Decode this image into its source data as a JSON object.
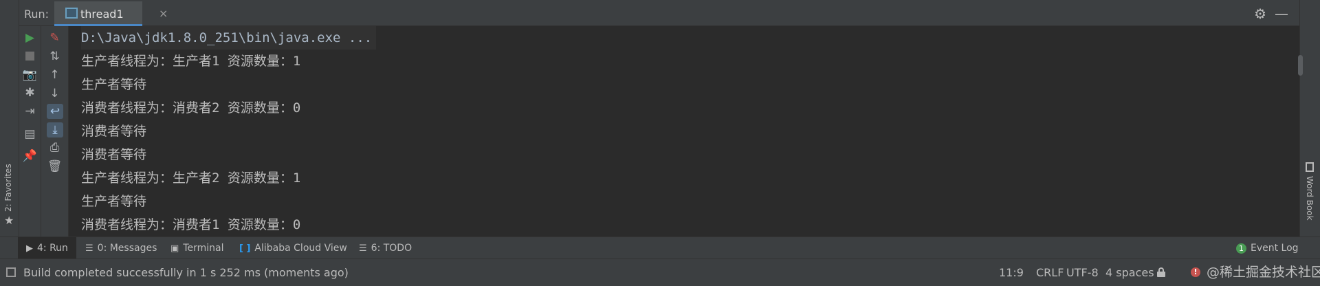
{
  "run_header": {
    "run_label": "Run:",
    "tab_label": "thread1",
    "tab_close": "×",
    "settings_icon": "⚙",
    "minimize_icon": "—"
  },
  "left_strip": {
    "favorites_label": "2: Favorites",
    "star_icon": "★"
  },
  "right_strip": {
    "wordbook_label": "Word Book"
  },
  "toolbar_1": [
    {
      "name": "rerun-icon",
      "glyph": "▶",
      "state": "active"
    },
    {
      "name": "stop-icon",
      "glyph": "■",
      "state": "disabled"
    },
    {
      "name": "camera-icon",
      "glyph": "📷",
      "state": "normal"
    },
    {
      "name": "debug-icon",
      "glyph": "✱",
      "state": "normal"
    },
    {
      "name": "exit-icon",
      "glyph": "⇥",
      "state": "normal"
    },
    {
      "name": "layout-icon",
      "glyph": "▤",
      "state": "normal"
    },
    {
      "name": "pin-icon",
      "glyph": "📌",
      "state": "normal"
    }
  ],
  "toolbar_2": [
    {
      "name": "clear-icon",
      "glyph": "✎",
      "state": "red"
    },
    {
      "name": "sort-icon",
      "glyph": "⇅",
      "state": "normal"
    },
    {
      "name": "up-arrow-icon",
      "glyph": "↑",
      "state": "normal"
    },
    {
      "name": "down-arrow-icon",
      "glyph": "↓",
      "state": "normal"
    },
    {
      "name": "soft-wrap-icon",
      "glyph": "↩",
      "state": "selected"
    },
    {
      "name": "scroll-to-end-icon",
      "glyph": "⤓",
      "state": "selected"
    },
    {
      "name": "print-icon",
      "glyph": "⎙",
      "state": "normal"
    },
    {
      "name": "trash-icon",
      "glyph": "🗑",
      "state": "normal"
    }
  ],
  "console": {
    "lines": [
      "D:\\Java\\jdk1.8.0_251\\bin\\java.exe ...",
      "生产者线程为：生产者1 资源数量：1",
      "生产者等待",
      "消费者线程为：消费者2 资源数量：0",
      "消费者等待",
      "消费者等待",
      "生产者线程为：生产者2 资源数量：1",
      "生产者等待",
      "消费者线程为：消费者1 资源数量：0"
    ]
  },
  "tool_window_bar": {
    "run": {
      "label": "4: Run",
      "icon": "▶"
    },
    "messages": {
      "label": "0: Messages",
      "icon": "☰"
    },
    "terminal": {
      "label": "Terminal",
      "icon": "▣"
    },
    "alibaba": {
      "label": "Alibaba Cloud View",
      "icon": "[ ]"
    },
    "todo": {
      "label": "6: TODO",
      "icon": "☰"
    },
    "event_log": {
      "label": "Event Log",
      "badge": "1"
    }
  },
  "status_bar": {
    "message": "Build completed successfully in 1 s 252 ms (moments ago)",
    "position": "11:9",
    "line_separator": "CRLF",
    "encoding": "UTF-8",
    "indent": "4 spaces",
    "error_icon": "!",
    "watermark": "@稀土掘金技术社区"
  },
  "colors": {
    "accent": "#4a88c7",
    "run_green": "#499c54",
    "error_red": "#c75450",
    "panel_bg": "#3c3f41",
    "console_bg": "#2b2b2b"
  }
}
